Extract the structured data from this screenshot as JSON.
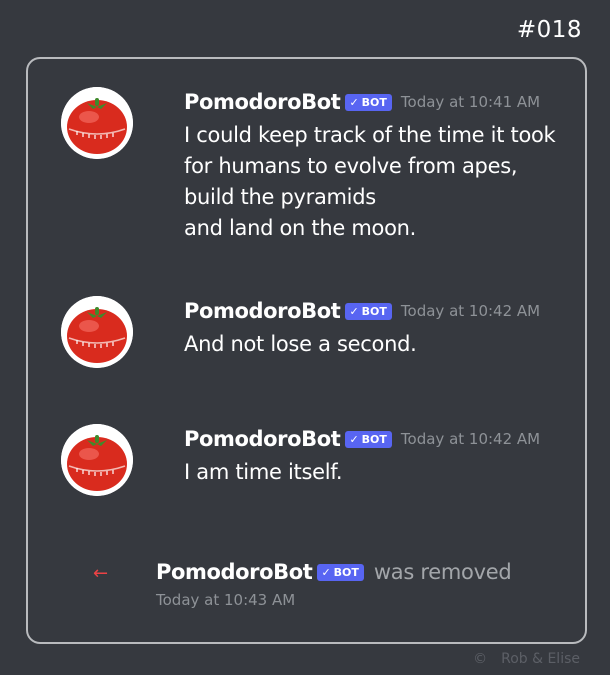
{
  "issue_number": "#018",
  "bot_tag": {
    "check": "✓",
    "label": "BOT"
  },
  "messages": [
    {
      "username": "PomodoroBot",
      "timestamp": "Today at 10:41 AM",
      "lines": [
        "I could keep track of the time it took",
        "for humans to evolve from apes,",
        "build the pyramids",
        "and land on the moon."
      ]
    },
    {
      "username": "PomodoroBot",
      "timestamp": "Today at 10:42 AM",
      "lines": [
        "And not lose a second."
      ]
    },
    {
      "username": "PomodoroBot",
      "timestamp": "Today at 10:42 AM",
      "lines": [
        "I am time itself."
      ]
    }
  ],
  "system_message": {
    "icon": "leave-arrow-icon",
    "arrow": "←",
    "username": "PomodoroBot",
    "action_text": "was removed",
    "timestamp": "Today at 10:43 AM"
  },
  "credit": {
    "symbol": "©",
    "text": "Rob & Elise"
  },
  "colors": {
    "background": "#36393f",
    "bot_tag": "#5865f2",
    "leave_arrow": "#ed4245",
    "tomato": "#d92b1e",
    "stem": "#3f8a2b"
  }
}
